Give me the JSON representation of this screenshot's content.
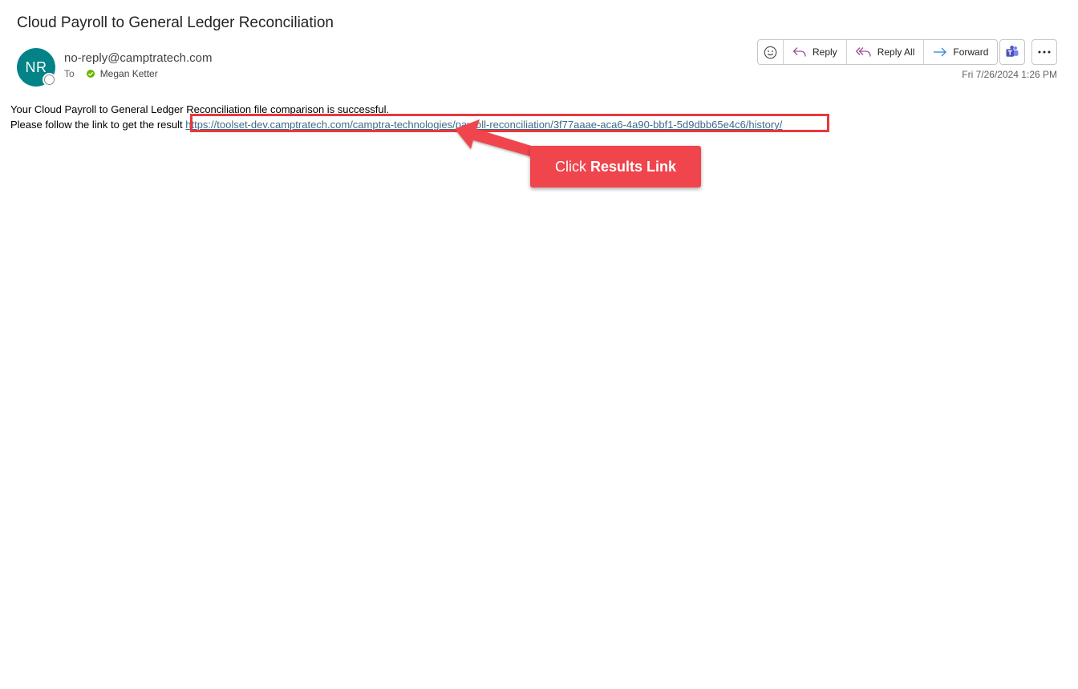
{
  "email": {
    "subject": "Cloud Payroll to General Ledger Reconciliation",
    "avatar_initials": "NR",
    "sender": "no-reply@camptratech.com",
    "to_label": "To",
    "recipient": "Megan Ketter",
    "timestamp": "Fri 7/26/2024 1:26 PM",
    "body_line1": "Your Cloud Payroll to General Ledger Reconciliation file comparison is successful.",
    "body_line2_prefix": "Please follow the link to get the result ",
    "link": "https://toolset-dev.camptratech.com/camptra-technologies/payroll-reconciliation/3f77aaae-aca6-4a90-bbf1-5d9dbb65e4c6/history/"
  },
  "actions": {
    "emoji_icon": "smiley-icon",
    "reply": "Reply",
    "reply_all": "Reply All",
    "forward": "Forward",
    "teams_icon": "teams-icon",
    "more_icon": "more-options-icon"
  },
  "callout": {
    "prefix": "Click",
    "emphasis": "Results Link"
  },
  "colors": {
    "avatar": "#038387",
    "callout": "#f0454d",
    "highlight": "#e8383d",
    "link": "#3d6b8a"
  }
}
